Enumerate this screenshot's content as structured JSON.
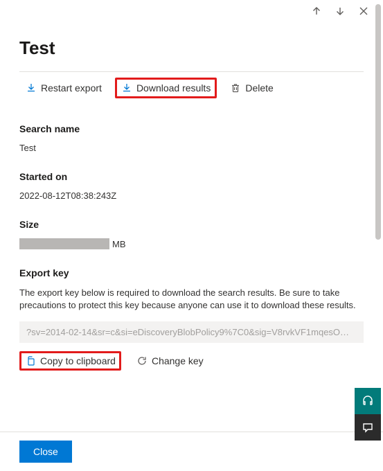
{
  "title": "Test",
  "toolbar": {
    "restart": "Restart export",
    "download": "Download results",
    "delete": "Delete"
  },
  "sections": {
    "search_name": {
      "label": "Search name",
      "value": "Test"
    },
    "started_on": {
      "label": "Started on",
      "value": "2022-08-12T08:38:243Z"
    },
    "size": {
      "label": "Size",
      "unit": "MB"
    },
    "export_key": {
      "label": "Export key",
      "description": "The export key below is required to download the search results. Be sure to take precautions to protect this key because anyone can use it to download these results.",
      "key_preview": "?sv=2014-02-14&sr=c&si=eDiscoveryBlobPolicy9%7C0&sig=V8rvkVF1mqesO…",
      "copy": "Copy to clipboard",
      "change": "Change key"
    }
  },
  "footer": {
    "close": "Close"
  }
}
